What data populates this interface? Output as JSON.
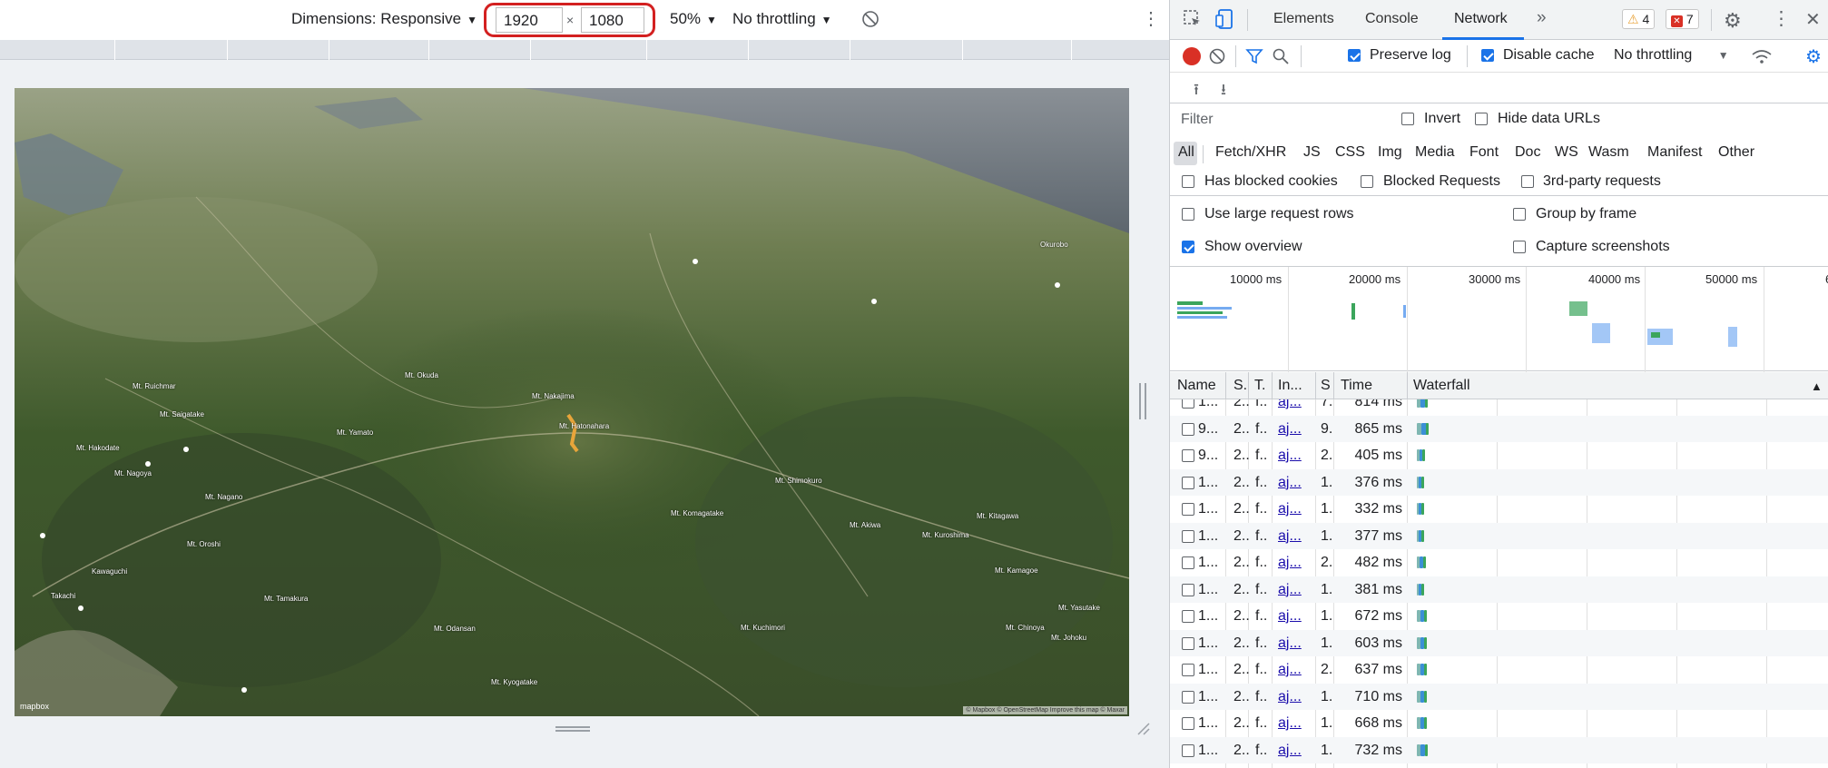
{
  "device_toolbar": {
    "dimensions_label": "Dimensions: Responsive",
    "width_value": "1920",
    "times_sign": "×",
    "height_value": "1080",
    "zoom": "50%",
    "throttling": "No throttling"
  },
  "devtools": {
    "tabs": [
      "Elements",
      "Console",
      "Network"
    ],
    "active_tab": "Network",
    "more_tabs": "»",
    "warnings_count": "4",
    "errors_count": "7"
  },
  "network": {
    "preserve_log_label": "Preserve log",
    "disable_cache_label": "Disable cache",
    "throttling_label": "No throttling",
    "filter_placeholder": "Filter",
    "invert_label": "Invert",
    "hide_data_urls_label": "Hide data URLs",
    "type_filters": [
      "All",
      "Fetch/XHR",
      "JS",
      "CSS",
      "Img",
      "Media",
      "Font",
      "Doc",
      "WS",
      "Wasm",
      "Manifest",
      "Other"
    ],
    "has_blocked_cookies_label": "Has blocked cookies",
    "blocked_requests_label": "Blocked Requests",
    "third_party_label": "3rd-party requests",
    "large_rows_label": "Use large request rows",
    "group_by_frame_label": "Group by frame",
    "show_overview_label": "Show overview",
    "capture_screenshots_label": "Capture screenshots",
    "overview_ticks": [
      "10000 ms",
      "20000 ms",
      "30000 ms",
      "40000 ms",
      "50000 ms",
      "6"
    ],
    "columns": [
      "Name",
      "S.",
      "T.",
      "In...",
      "S",
      "Time",
      "Waterfall"
    ],
    "sort_indicator": "▲",
    "rows": [
      {
        "name": "1...",
        "status": "2..",
        "type": "f..",
        "initiator": "aj...",
        "size": "7.",
        "time": "814 ms",
        "wf": 0.3
      },
      {
        "name": "9...",
        "status": "2..",
        "type": "f..",
        "initiator": "aj...",
        "size": "9.",
        "time": "865 ms",
        "wf": 0.33
      },
      {
        "name": "9...",
        "status": "2..",
        "type": "f..",
        "initiator": "aj...",
        "size": "2.",
        "time": "405 ms",
        "wf": 0.2
      },
      {
        "name": "1...",
        "status": "2..",
        "type": "f..",
        "initiator": "aj...",
        "size": "1.",
        "time": "376 ms",
        "wf": 0.18
      },
      {
        "name": "1...",
        "status": "2..",
        "type": "f..",
        "initiator": "aj...",
        "size": "1.",
        "time": "332 ms",
        "wf": 0.16
      },
      {
        "name": "1...",
        "status": "2..",
        "type": "f..",
        "initiator": "aj...",
        "size": "1.",
        "time": "377 ms",
        "wf": 0.18
      },
      {
        "name": "1...",
        "status": "2..",
        "type": "f..",
        "initiator": "aj...",
        "size": "2.",
        "time": "482 ms",
        "wf": 0.22
      },
      {
        "name": "1...",
        "status": "2..",
        "type": "f..",
        "initiator": "aj...",
        "size": "1.",
        "time": "381 ms",
        "wf": 0.18
      },
      {
        "name": "1...",
        "status": "2..",
        "type": "f..",
        "initiator": "aj...",
        "size": "1.",
        "time": "672 ms",
        "wf": 0.27
      },
      {
        "name": "1...",
        "status": "2..",
        "type": "f..",
        "initiator": "aj...",
        "size": "1.",
        "time": "603 ms",
        "wf": 0.25
      },
      {
        "name": "1...",
        "status": "2..",
        "type": "f..",
        "initiator": "aj...",
        "size": "2.",
        "time": "637 ms",
        "wf": 0.26
      },
      {
        "name": "1...",
        "status": "2..",
        "type": "f..",
        "initiator": "aj...",
        "size": "1.",
        "time": "710 ms",
        "wf": 0.28
      },
      {
        "name": "1...",
        "status": "2..",
        "type": "f..",
        "initiator": "aj...",
        "size": "1.",
        "time": "668 ms",
        "wf": 0.27
      },
      {
        "name": "1...",
        "status": "2..",
        "type": "f..",
        "initiator": "aj...",
        "size": "1.",
        "time": "732 ms",
        "wf": 0.29
      }
    ]
  },
  "map": {
    "labels": [
      "Mt. Ruichmar",
      "Mt. Okuda",
      "Mt. Nakajima",
      "Mt. Hatonahara",
      "Mt. Saigatake",
      "Mt. Yamato",
      "Mt. Komagatake",
      "Mt. Shimokuro",
      "Mt. Kuchimori",
      "Mt. Kyogatake",
      "Mt. Odansan",
      "Mt. Nagano",
      "Mt. Oroshi",
      "Mt. Akiwa",
      "Mt. Kitagawa",
      "Mt. Kuroshima",
      "Mt. Kamagoe",
      "Mt. Nagoya",
      "Mt. Hakodate",
      "Mt. Chinoya",
      "Mt. Johoku",
      "Mt. Yasutake",
      "Mt. Tamakura",
      "Kawaguchi",
      "Takachi",
      "Okurobo"
    ],
    "logo": "mapbox",
    "attribution": "© Mapbox © OpenStreetMap Improve this map © Maxar"
  },
  "colors": {
    "accent": "#1a73e8",
    "record": "#d93025",
    "highlight": "#d32020"
  }
}
